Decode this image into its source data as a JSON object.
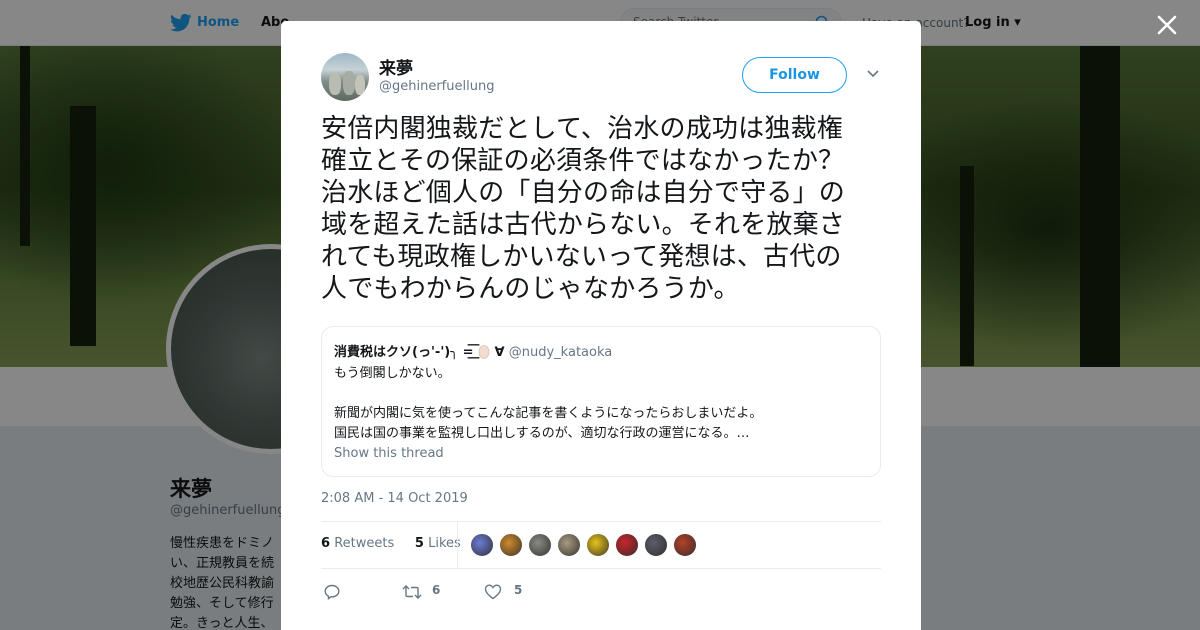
{
  "topbar": {
    "home_label": "Home",
    "about_label": "Abo",
    "search_placeholder": "Search Twitter",
    "have_account": "Have an account?",
    "login_label": "Log in"
  },
  "background_profile": {
    "name": "来夢",
    "handle": "@gehinerfuellung",
    "bio_lines": [
      "慢性疾患をドミノ",
      "い、正規教員を続",
      "校地歴公民科教諭",
      "勉強、そして修行",
      "定。きっと人生、"
    ]
  },
  "tweet": {
    "author_name": "来夢",
    "author_handle": "@gehinerfuellung",
    "follow_label": "Follow",
    "text_lines": [
      "安倍内閣独裁だとして、治水の成功は独裁権",
      "確立とその保証の必須条件ではなかったか？",
      "治水ほど個人の「自分の命は自分で守る」の",
      "域を超えた話は古代からない。それを放棄さ",
      "れても現政権しかいないって発想は、古代の",
      "人でもわからんのじゃなかろうか。"
    ],
    "timestamp": "2:08 AM - 14 Oct 2019",
    "retweets_count": "6",
    "retweets_label": "Retweets",
    "likes_count": "5",
    "likes_label": "Likes",
    "action_retweet_count": "6",
    "action_like_count": "5"
  },
  "quoted_tweet": {
    "author_name": "消費税はクソ(っ'-')╮ =͟͟͞͞ ",
    "author_suffix": " ∀",
    "author_handle": "@nudy_kataoka",
    "line1": "もう倒閣しかない。",
    "line2": "新聞が内閣に気を使ってこんな記事を書くようになったらおしまいだよ。",
    "line3": "国民は国の事業を監視し口出しするのが、適切な行政の運営になる。…",
    "show_thread": "Show this thread"
  },
  "liker_colors": [
    "#6b7bd1",
    "#d08a2c",
    "#8a8a84",
    "#a89a7e",
    "#e8c21a",
    "#c8252c",
    "#5a5e68",
    "#b5412a"
  ],
  "colors": {
    "accent": "#1da1f2",
    "text_primary": "#14171a",
    "text_secondary": "#657786"
  }
}
